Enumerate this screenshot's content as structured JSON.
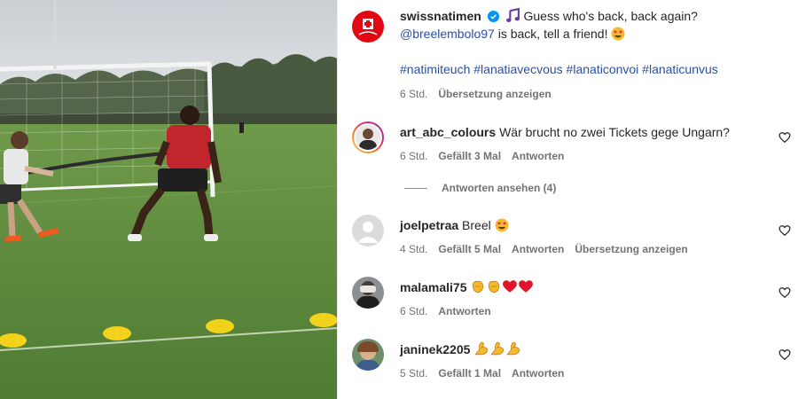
{
  "post": {
    "author": "swissnatimen",
    "caption_line1": "Guess who's back, back again?",
    "mention": "@breelembolo97",
    "caption_line2": " is back, tell a friend!",
    "hashtags": "#natimiteuch #lanatiavecvous #lanaticonvoi #lanaticunvus",
    "time": "6 Std.",
    "translate": "Übersetzung anzeigen"
  },
  "comments": [
    {
      "user": "art_abc_colours",
      "text": "Wär brucht no zwei Tickets gege Ungarn?",
      "time": "6 Std.",
      "likes": "Gefällt 3 Mal",
      "reply": "Antworten",
      "view_replies": "Antworten ansehen (4)"
    },
    {
      "user": "joelpetraa",
      "text": "Breel",
      "time": "4 Std.",
      "likes": "Gefällt 5 Mal",
      "reply": "Antworten",
      "translate": "Übersetzung anzeigen"
    },
    {
      "user": "malamali75",
      "text": "",
      "time": "6 Std.",
      "reply": "Antworten"
    },
    {
      "user": "janinek2205",
      "text": "",
      "time": "5 Std.",
      "likes": "Gefällt 1 Mal",
      "reply": "Antworten"
    }
  ],
  "icons": {
    "verified": "verified-badge-icon",
    "heart": "heart-outline-icon",
    "music": "music-notes-emoji",
    "heart_eyes": "heart-eyes-emoji",
    "clap": "clapping-hands-emoji",
    "red_heart": "red-heart-emoji",
    "flex": "flexed-biceps-emoji"
  },
  "colors": {
    "link": "#2b4f9e",
    "verified": "#0095f6",
    "swiss_red": "#e30613",
    "meta": "#737373"
  }
}
